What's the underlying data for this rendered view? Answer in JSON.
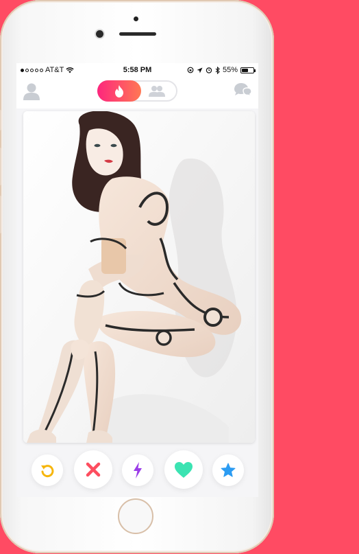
{
  "status_bar": {
    "carrier": "AT&T",
    "time": "5:58 PM",
    "battery": "55%",
    "battery_level": 0.55,
    "signal_dots_filled": 1
  },
  "top_bar": {
    "profile_icon": "profile-icon",
    "discover_icon": "flame-icon",
    "social_icon": "group-icon",
    "messages_icon": "chat-bubbles-icon"
  },
  "card": {
    "photo": "profile-photo"
  },
  "actions": [
    {
      "name": "rewind",
      "icon": "rewind-icon",
      "color": "#f6b60d"
    },
    {
      "name": "nope",
      "icon": "close-icon",
      "color": "#fd4d5f"
    },
    {
      "name": "boost",
      "icon": "lightning-icon",
      "color": "#9b3de8"
    },
    {
      "name": "like",
      "icon": "heart-icon",
      "color": "#3be3b2"
    },
    {
      "name": "super-like",
      "icon": "star-icon",
      "color": "#2c9cf2"
    }
  ],
  "colors": {
    "background": "#ff4b63",
    "brand_gradient_start": "#fd267d",
    "brand_gradient_end": "#ff7854"
  }
}
